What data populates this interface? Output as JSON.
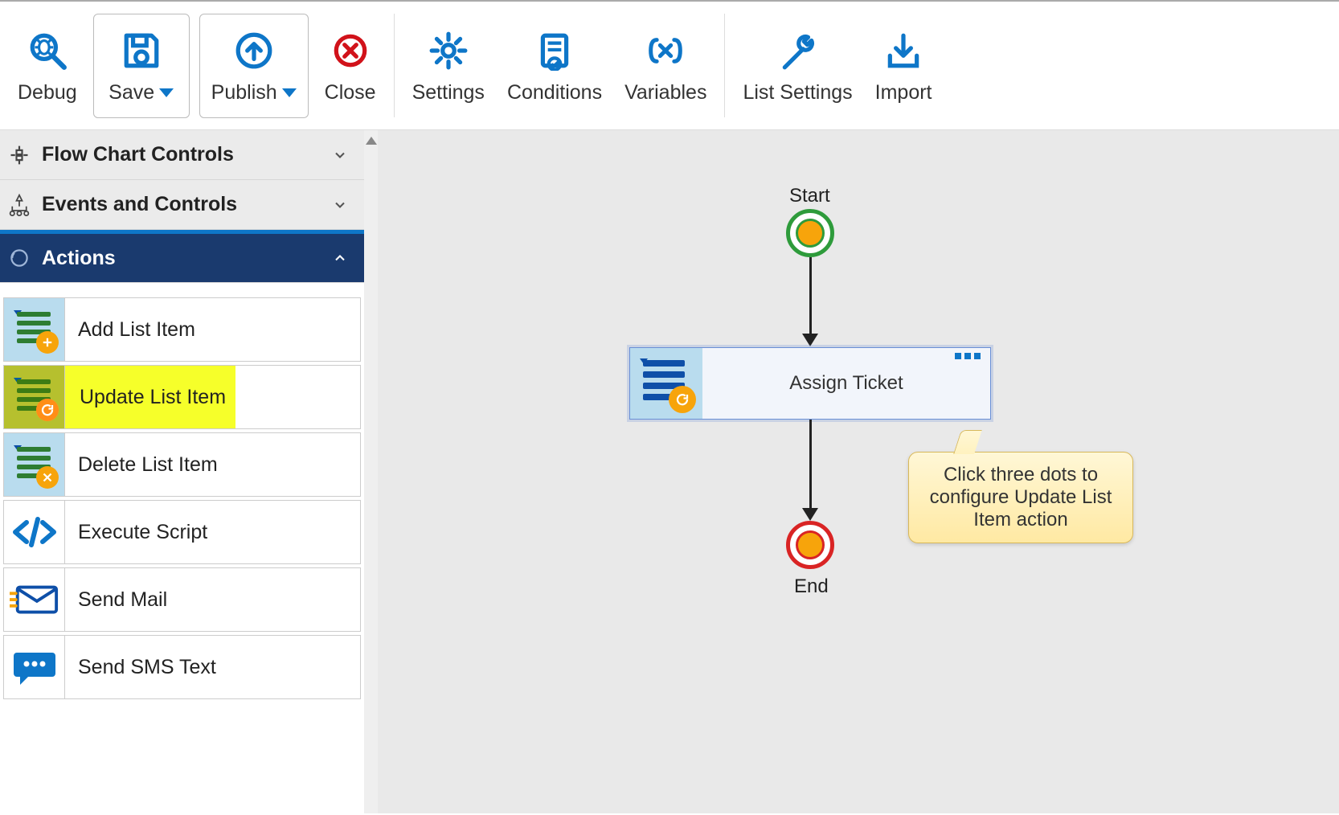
{
  "toolbar": {
    "debug": "Debug",
    "save": "Save",
    "publish": "Publish",
    "close": "Close",
    "settings": "Settings",
    "conditions": "Conditions",
    "variables": "Variables",
    "list_settings": "List Settings",
    "import": "Import"
  },
  "sidebar": {
    "groups": [
      {
        "label": "Flow Chart Controls",
        "expanded": false
      },
      {
        "label": "Events and Controls",
        "expanded": false
      },
      {
        "label": "Actions",
        "expanded": true
      }
    ],
    "actions": [
      {
        "label": "Add List Item",
        "badge": "add",
        "highlight": false
      },
      {
        "label": "Update List Item",
        "badge": "refresh",
        "highlight": true
      },
      {
        "label": "Delete List Item",
        "badge": "delete",
        "highlight": false
      },
      {
        "label": "Execute Script",
        "badge": "code",
        "highlight": false
      },
      {
        "label": "Send Mail",
        "badge": "mail",
        "highlight": false
      },
      {
        "label": "Send SMS Text",
        "badge": "sms",
        "highlight": false
      }
    ]
  },
  "canvas": {
    "start_label": "Start",
    "end_label": "End",
    "node_title": "Assign Ticket",
    "callout_text": "Click three dots to configure Update List Item action"
  }
}
